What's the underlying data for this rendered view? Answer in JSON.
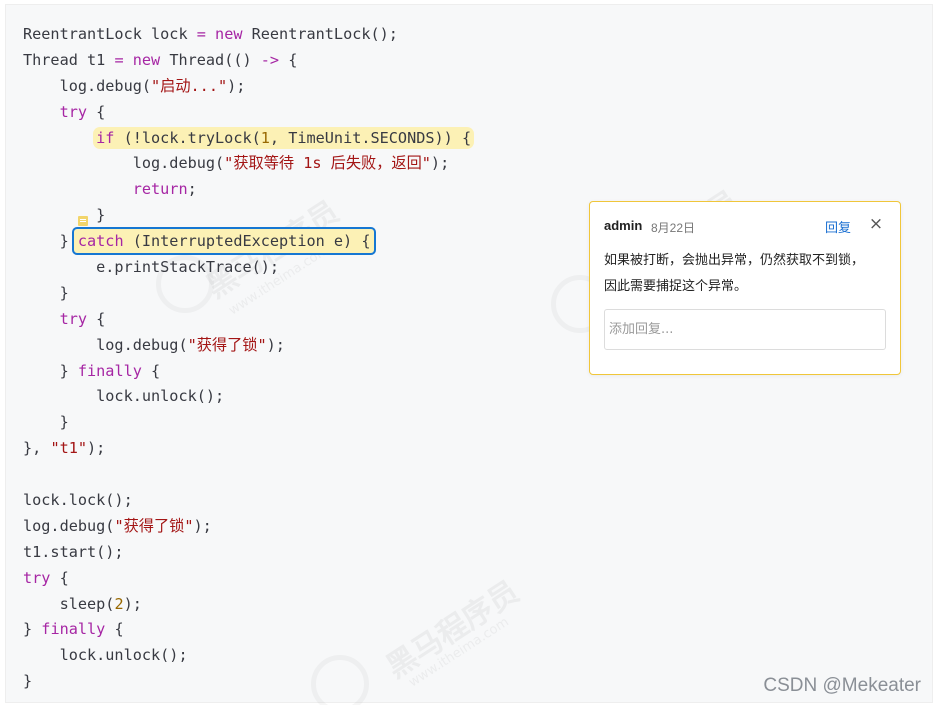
{
  "watermark": {
    "brand": "黑马程序员",
    "url": "www.itheima.com"
  },
  "code_lines": [
    [
      {
        "t": "ReentrantLock lock ",
        "c": "tk"
      },
      {
        "t": "=",
        "c": "kw"
      },
      {
        "t": " ",
        "c": "tk"
      },
      {
        "t": "new",
        "c": "kw"
      },
      {
        "t": " ReentrantLock();",
        "c": "tk"
      }
    ],
    [
      {
        "t": "Thread t1 ",
        "c": "tk"
      },
      {
        "t": "=",
        "c": "kw"
      },
      {
        "t": " ",
        "c": "tk"
      },
      {
        "t": "new",
        "c": "kw"
      },
      {
        "t": " Thread(() ",
        "c": "tk"
      },
      {
        "t": "->",
        "c": "kw"
      },
      {
        "t": " {",
        "c": "tk"
      }
    ],
    [
      {
        "t": "    log.debug(",
        "c": "tk"
      },
      {
        "t": "\"启动...\"",
        "c": "str"
      },
      {
        "t": ");",
        "c": "tk"
      }
    ],
    [
      {
        "t": "    ",
        "c": "tk"
      },
      {
        "t": "try",
        "c": "kw"
      },
      {
        "t": " {",
        "c": "tk"
      }
    ],
    [
      {
        "t": "        ",
        "c": "tk"
      },
      {
        "hl": "yellow",
        "parts": [
          {
            "t": "if",
            "c": "kw"
          },
          {
            "t": " (!lock.tryLock(",
            "c": "tk"
          },
          {
            "t": "1",
            "c": "num"
          },
          {
            "t": ", TimeUnit.SECONDS)) {",
            "c": "tk"
          }
        ]
      }
    ],
    [
      {
        "t": "            log.debug(",
        "c": "tk"
      },
      {
        "t": "\"获取等待 1s 后失败，返回\"",
        "c": "str"
      },
      {
        "t": ");",
        "c": "tk"
      }
    ],
    [
      {
        "t": "            ",
        "c": "tk"
      },
      {
        "t": "return",
        "c": "kw"
      },
      {
        "t": ";",
        "c": "tk"
      }
    ],
    [
      {
        "t": "        }",
        "c": "tk"
      }
    ],
    [
      {
        "t": "    } ",
        "c": "tk"
      },
      {
        "hl": "blue",
        "parts": [
          {
            "t": "catch",
            "c": "kw"
          },
          {
            "t": " (InterruptedException e) {",
            "c": "tk"
          }
        ]
      }
    ],
    [
      {
        "t": "        e.printStackTrace();",
        "c": "tk"
      }
    ],
    [
      {
        "t": "    }",
        "c": "tk"
      }
    ],
    [
      {
        "t": "    ",
        "c": "tk"
      },
      {
        "t": "try",
        "c": "kw"
      },
      {
        "t": " {",
        "c": "tk"
      }
    ],
    [
      {
        "t": "        log.debug(",
        "c": "tk"
      },
      {
        "t": "\"获得了锁\"",
        "c": "str"
      },
      {
        "t": ");",
        "c": "tk"
      }
    ],
    [
      {
        "t": "    } ",
        "c": "tk"
      },
      {
        "t": "finally",
        "c": "kw"
      },
      {
        "t": " {",
        "c": "tk"
      }
    ],
    [
      {
        "t": "        lock.unlock();",
        "c": "tk"
      }
    ],
    [
      {
        "t": "    }",
        "c": "tk"
      }
    ],
    [
      {
        "t": "}, ",
        "c": "tk"
      },
      {
        "t": "\"t1\"",
        "c": "str"
      },
      {
        "t": ");",
        "c": "tk"
      }
    ],
    [
      {
        "t": "",
        "c": "tk"
      }
    ],
    [
      {
        "t": "lock.lock();",
        "c": "tk"
      }
    ],
    [
      {
        "t": "log.debug(",
        "c": "tk"
      },
      {
        "t": "\"获得了锁\"",
        "c": "str"
      },
      {
        "t": ");",
        "c": "tk"
      }
    ],
    [
      {
        "t": "t1.start();",
        "c": "tk"
      }
    ],
    [
      {
        "t": "try",
        "c": "kw"
      },
      {
        "t": " {",
        "c": "tk"
      }
    ],
    [
      {
        "t": "    sleep(",
        "c": "tk"
      },
      {
        "t": "2",
        "c": "num"
      },
      {
        "t": ");",
        "c": "tk"
      }
    ],
    [
      {
        "t": "} ",
        "c": "tk"
      },
      {
        "t": "finally",
        "c": "kw"
      },
      {
        "t": " {",
        "c": "tk"
      }
    ],
    [
      {
        "t": "    lock.unlock();",
        "c": "tk"
      }
    ],
    [
      {
        "t": "}",
        "c": "tk"
      }
    ]
  ],
  "comment": {
    "author": "admin",
    "date": "8月22日",
    "reply_label": "回复",
    "close_icon": "×",
    "body_line1": "如果被打断，会抛出异常，仍然获取不到锁，",
    "body_line2": "因此需要捕捉这个异常。",
    "reply_placeholder": "添加回复..."
  },
  "footer": {
    "credit": "CSDN @Mekeater"
  },
  "colors": {
    "keyword": "#a626a4",
    "string": "#a31515",
    "number": "#986801",
    "highlight": "#fcf1b5",
    "focus_border": "#1677d2",
    "comment_border": "#f0c63a",
    "reply_link": "#1a6fd1"
  }
}
